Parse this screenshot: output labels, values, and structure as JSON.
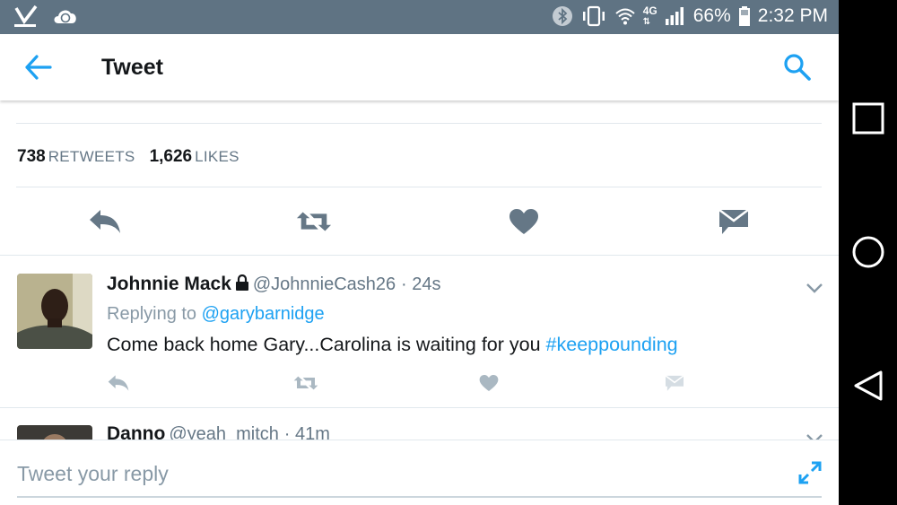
{
  "status_bar": {
    "battery": "66%",
    "time": "2:32 PM",
    "network": "4G",
    "icons": [
      "verizon-check-icon",
      "sync-cloud-icon",
      "bluetooth-icon",
      "vibrate-icon",
      "wifi-icon",
      "lte-icon",
      "signal-icon",
      "battery-icon"
    ]
  },
  "header": {
    "title": "Tweet",
    "back_icon": "arrow-left-icon",
    "search_icon": "search-icon"
  },
  "main_tweet": {
    "retweet_count": "738",
    "retweet_label": "RETWEETS",
    "like_count": "1,626",
    "like_label": "LIKES",
    "actions": [
      "reply-icon",
      "retweet-icon",
      "heart-icon",
      "message-icon"
    ]
  },
  "replies": [
    {
      "name": "Johnnie Mack",
      "protected": true,
      "handle": "@JohnnieCash26",
      "time": "· 24s",
      "replying_label": "Replying to",
      "replying_to": "@garybarnidge",
      "text": "Come back home Gary...Carolina is waiting for you",
      "hashtag": "#keeppounding"
    },
    {
      "name": "Danno",
      "handle": "@yeah_mitch",
      "time": "· 41m"
    }
  ],
  "reply_bar": {
    "placeholder": "Tweet your reply",
    "expand_icon": "expand-icon"
  },
  "colors": {
    "accent": "#1da1f2",
    "status_bar": "#5f7383",
    "action_icon": "#657786",
    "muted": "#8899a6"
  }
}
